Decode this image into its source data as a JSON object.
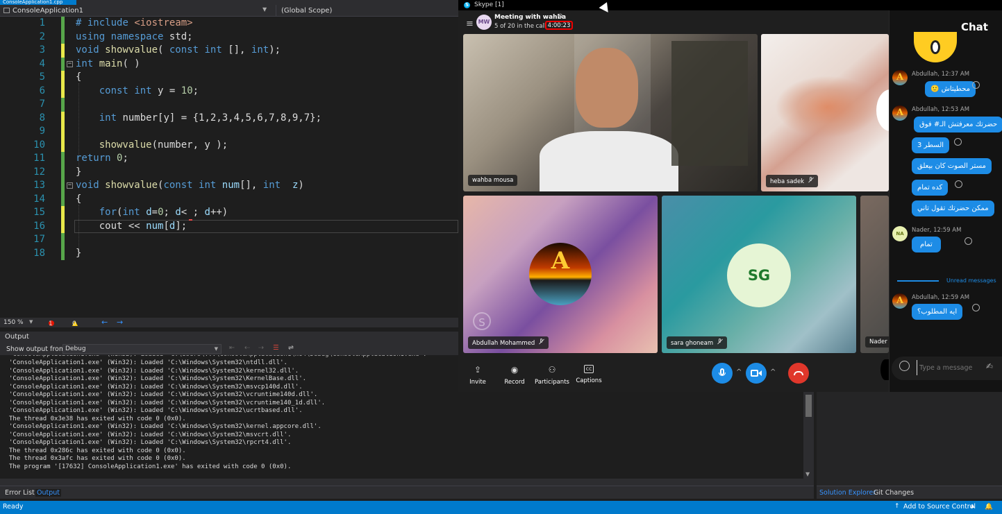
{
  "vs": {
    "tab_title": "ConsoleApplication1.cpp",
    "project_name": "ConsoleApplication1",
    "scope": "(Global Scope)",
    "zoom": "150 %",
    "error_count": "1",
    "warning_count": "0",
    "code_lines": [
      {
        "n": "1",
        "text": "# include <iostream>"
      },
      {
        "n": "2",
        "text": "using namespace std;"
      },
      {
        "n": "3",
        "text": "void showvalue( const int [], int);"
      },
      {
        "n": "4",
        "text": "int main( )"
      },
      {
        "n": "5",
        "text": "{"
      },
      {
        "n": "6",
        "text": "const int y = 10;"
      },
      {
        "n": "7",
        "text": ""
      },
      {
        "n": "8",
        "text": "int number[y] = {1,2,3,4,5,6,7,8,9,7};"
      },
      {
        "n": "9",
        "text": ""
      },
      {
        "n": "10",
        "text": "showvalue(number, y );"
      },
      {
        "n": "11",
        "text": "return 0;"
      },
      {
        "n": "12",
        "text": "}"
      },
      {
        "n": "13",
        "text": "void showvalue(const int num[], int  z)"
      },
      {
        "n": "14",
        "text": "{"
      },
      {
        "n": "15",
        "text": "for(int d=0; d< ; d++)"
      },
      {
        "n": "16",
        "text": "cout << num[d];"
      },
      {
        "n": "17",
        "text": ""
      },
      {
        "n": "18",
        "text": "}"
      }
    ],
    "output_title": "Output",
    "show_output_from_label": "Show output from:",
    "show_output_from_value": "Debug",
    "output_lines": [
      "'ConsoleApplication1.exe' (Win32): Loaded 'C:\\Windows\\System32\\ntdll.dll'.",
      "'ConsoleApplication1.exe' (Win32): Loaded 'C:\\Windows\\System32\\kernel32.dll'.",
      "'ConsoleApplication1.exe' (Win32): Loaded 'C:\\Windows\\System32\\KernelBase.dll'.",
      "'ConsoleApplication1.exe' (Win32): Loaded 'C:\\Windows\\System32\\msvcp140d.dll'.",
      "'ConsoleApplication1.exe' (Win32): Loaded 'C:\\Windows\\System32\\vcruntime140d.dll'.",
      "'ConsoleApplication1.exe' (Win32): Loaded 'C:\\Windows\\System32\\vcruntime140_1d.dll'.",
      "'ConsoleApplication1.exe' (Win32): Loaded 'C:\\Windows\\System32\\ucrtbased.dll'.",
      "The thread 0x3e38 has exited with code 0 (0x0).",
      "'ConsoleApplication1.exe' (Win32): Loaded 'C:\\Windows\\System32\\kernel.appcore.dll'.",
      "'ConsoleApplication1.exe' (Win32): Loaded 'C:\\Windows\\System32\\msvcrt.dll'.",
      "'ConsoleApplication1.exe' (Win32): Loaded 'C:\\Windows\\System32\\rpcrt4.dll'.",
      "The thread 0x286c has exited with code 0 (0x0).",
      "The thread 0x3afc has exited with code 0 (0x0).",
      "The program '[17632] ConsoleApplication1.exe' has exited with code 0 (0x0)."
    ],
    "bottom_tabs": [
      "Error List",
      "Output"
    ],
    "side_tabs": [
      "Solution Explorer",
      "Git Changes"
    ],
    "status_ready": "Ready",
    "status_source_control": "Add to Source Control"
  },
  "skype": {
    "window_title": "Skype [1]",
    "meeting_avatar": "MW",
    "meeting_title": "Meeting with wahba",
    "call_count": "5 of 20 in the call",
    "call_duration": "4:00:23",
    "participants": [
      {
        "name": "wahba mousa",
        "muted": false
      },
      {
        "name": "heba sadek",
        "muted": true
      },
      {
        "name": "Abdullah Mohammed",
        "muted": true
      },
      {
        "name": "sara ghoneam",
        "muted": true,
        "initials": "SG"
      },
      {
        "name": "Nader",
        "muted": false
      }
    ],
    "controls": {
      "invite": "Invite",
      "record": "Record",
      "participants": "Participants",
      "captions": "Captions"
    },
    "accent": "#1d8ce6",
    "end_call_color": "#e0372b"
  },
  "chat": {
    "title": "Chat",
    "groups": [
      {
        "sender": "Abdullah, 12:37 AM",
        "messages": [
          "محطيتاش 🙂"
        ]
      },
      {
        "sender": "Abdullah, 12:53 AM",
        "messages": [
          "حضرتك معرفتش الـ# فوق",
          "السطر 3",
          "مستر الصوت كان بيعلق",
          "كده تمام",
          "ممكن حضرتك تقول تاني"
        ]
      },
      {
        "sender": "Nader, 12:59 AM",
        "avatar": "NA",
        "messages": [
          "تمام"
        ]
      },
      {
        "sender": "Abdullah, 12:59 AM",
        "messages": [
          "ايه المطلوب؟"
        ]
      }
    ],
    "unread_label": "Unread messages",
    "input_placeholder": "Type a message"
  }
}
